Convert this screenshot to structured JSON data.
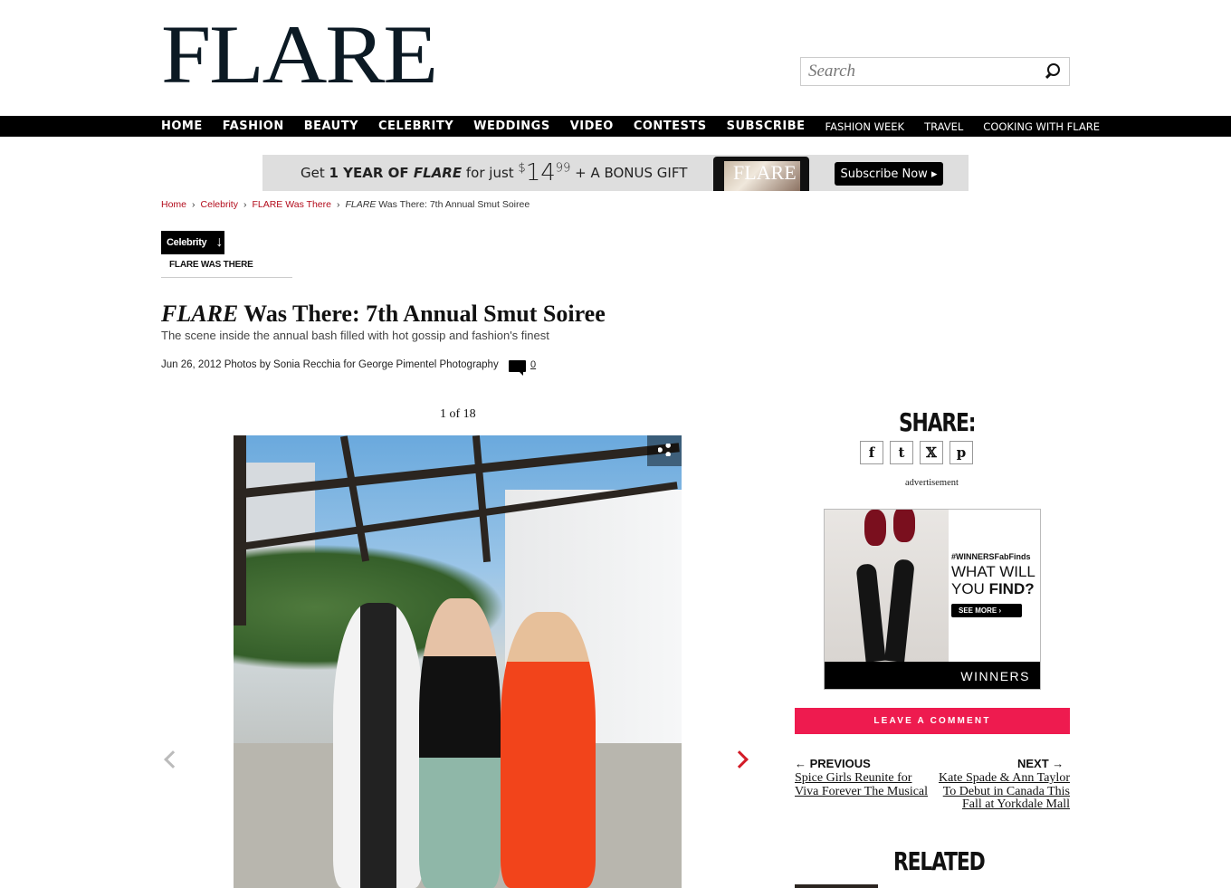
{
  "header": {
    "logo": "FLARE",
    "search_placeholder": "Search"
  },
  "nav": {
    "primary": [
      "HOME",
      "FASHION",
      "BEAUTY",
      "CELEBRITY",
      "WEDDINGS",
      "VIDEO",
      "CONTESTS",
      "SUBSCRIBE"
    ],
    "secondary": [
      "FASHION WEEK",
      "TRAVEL",
      "COOKING WITH FLARE"
    ]
  },
  "banner": {
    "pre": "Get ",
    "bold": "1 YEAR OF ",
    "bold_italic": "FLARE",
    "mid": " for just ",
    "price_dollar": "$",
    "price_main": "14",
    "price_cents": "99",
    "post": " + A BONUS GIFT",
    "magazine_logo": "FLARE",
    "button": "Subscribe Now ▸"
  },
  "breadcrumb": {
    "home": "Home",
    "celebrity": "Celebrity",
    "section": "FLARE Was There",
    "current_italic": "FLARE",
    "current_rest": " Was There: 7th Annual Smut Soiree",
    "sep": "›"
  },
  "category": {
    "label": "Celebrity",
    "arrow": "↓",
    "sub": "FLARE WAS THERE"
  },
  "article": {
    "title_italic": "FLARE",
    "title_rest": " Was There: 7th Annual Smut Soiree",
    "subtitle": "The scene inside the annual bash filled with hot gossip and fashion's finest",
    "byline": "Jun 26, 2012 Photos by Sonia Recchia for George Pimentel Photography",
    "comment_count": "0"
  },
  "gallery": {
    "counter": "1 of 18"
  },
  "sidebar": {
    "share_heading": "SHARE:",
    "share_buttons": [
      "f",
      "t",
      "𝕏",
      "p"
    ],
    "advertisement_label": "advertisement",
    "ad": {
      "tag": "#WINNERSFabFinds",
      "line1": "WHAT WILL",
      "line2a": "YOU ",
      "line2b": "FIND?",
      "button": "SEE MORE ›",
      "brand": "WINNERS"
    },
    "leave_comment": "LEAVE A COMMENT",
    "previous_label": "←  PREVIOUS",
    "next_label": "NEXT  →",
    "previous_link": "Spice Girls Reunite for Viva Forever The Musical",
    "next_link": "Kate Spade & Ann Taylor To Debut in Canada This Fall at Yorkdale Mall",
    "related_heading": "RELATED"
  }
}
